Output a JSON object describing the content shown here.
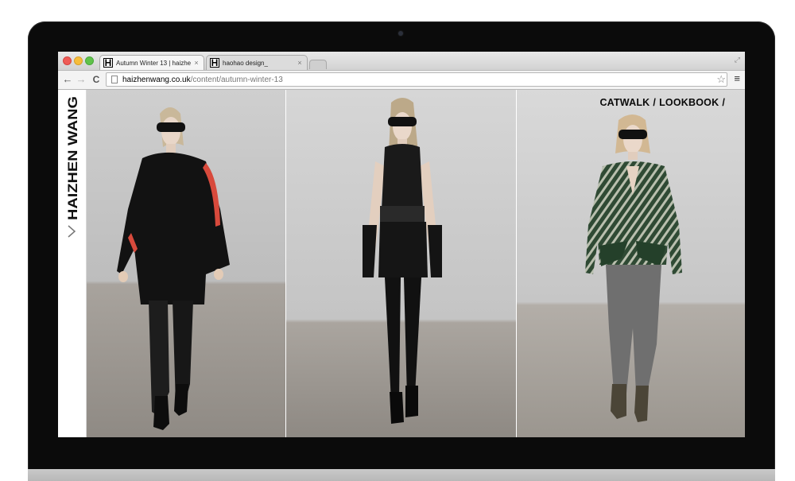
{
  "browser": {
    "tabs": [
      {
        "favicon": "H",
        "title": "Autumn Winter 13 | haizhe",
        "close": "×"
      },
      {
        "favicon": "H",
        "title": "haohao design_",
        "close": "×"
      }
    ],
    "url": {
      "domain": "haizhenwang.co.uk",
      "path": "/content/autumn-winter-13"
    },
    "icons": {
      "back": "back-arrow-icon",
      "forward": "forward-arrow-icon",
      "reload": "reload-icon",
      "bookmark": "star-icon",
      "menu": "hamburger-menu-icon"
    }
  },
  "site": {
    "brand": "HAIZHEN WANG",
    "nav": {
      "catwalk": "CATWALK",
      "sep1": "/",
      "lookbook": "LOOKBOOK",
      "sep2": "/"
    }
  },
  "photos": [
    {
      "name": "catwalk-look-1"
    },
    {
      "name": "catwalk-look-2"
    },
    {
      "name": "catwalk-look-3"
    }
  ],
  "colors": {
    "bezel": "#0b0b0b",
    "accent_red": "#e0473a",
    "jacket_green": "#2f4a34"
  }
}
